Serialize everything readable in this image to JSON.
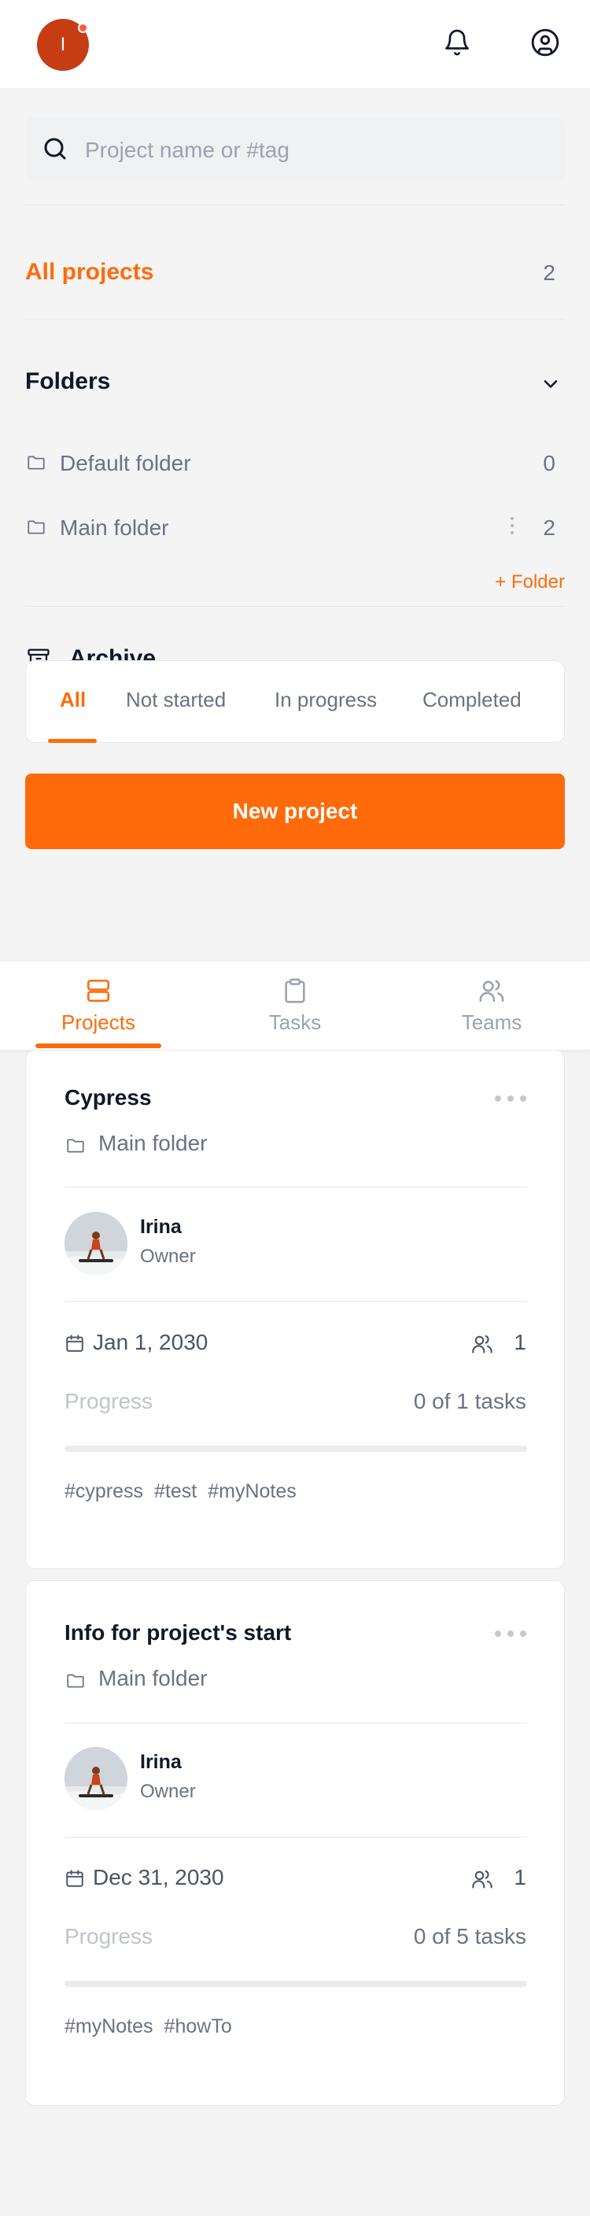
{
  "header": {
    "user_initial": "I",
    "has_notification_dot": true
  },
  "search": {
    "placeholder": "Project name or #tag"
  },
  "all_projects": {
    "label": "All projects",
    "count": "2"
  },
  "folders": {
    "label": "Folders",
    "expanded": true,
    "items": [
      {
        "name": "Default folder",
        "count": "0"
      },
      {
        "name": "Main folder",
        "count": "2"
      }
    ],
    "add_label": "+ Folder"
  },
  "archive": {
    "label": "Archive"
  },
  "filter_tabs": {
    "items": [
      "All",
      "Not started",
      "In progress",
      "Completed"
    ],
    "active": "All"
  },
  "new_project_label": "New project",
  "bottom_nav": {
    "items": [
      {
        "label": "Projects",
        "icon": "projects-icon",
        "active": true
      },
      {
        "label": "Tasks",
        "icon": "clipboard-icon",
        "active": false
      },
      {
        "label": "Teams",
        "icon": "team-icon",
        "active": false
      }
    ]
  },
  "projects": [
    {
      "title": "Cypress",
      "folder": "Main folder",
      "owner_name": "Irina",
      "owner_role": "Owner",
      "due_date": "Jan 1, 2030",
      "members": "1",
      "progress_label": "Progress",
      "progress_text": "0 of 1 tasks",
      "progress_fraction": 0,
      "tags": [
        "#cypress",
        "#test",
        "#myNotes"
      ]
    },
    {
      "title": "Info for project's start",
      "folder": "Main folder",
      "owner_name": "Irina",
      "owner_role": "Owner",
      "due_date": "Dec 31, 2030",
      "members": "1",
      "progress_label": "Progress",
      "progress_text": "0 of 5 tasks",
      "progress_fraction": 0,
      "tags": [
        "#myNotes",
        "#howTo"
      ]
    }
  ],
  "colors": {
    "accent": "#ff6b0a",
    "avatar_bg": "#c63d14",
    "text_primary": "#111827",
    "text_secondary": "#6b7280"
  }
}
